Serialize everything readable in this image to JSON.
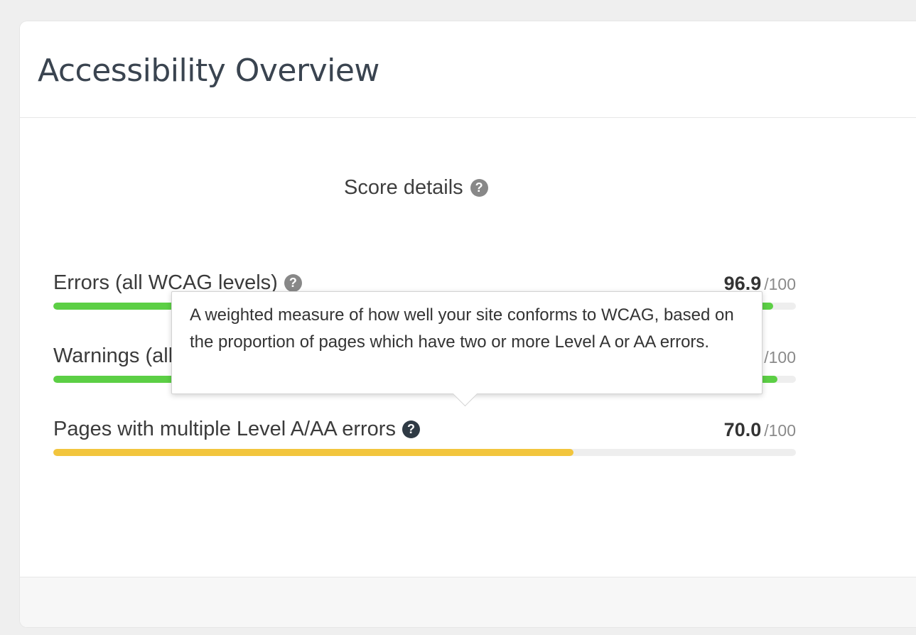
{
  "card": {
    "title": "Accessibility Overview"
  },
  "score_details": {
    "label": "Score details",
    "help_glyph": "?"
  },
  "metrics": [
    {
      "label": "Errors (all WCAG levels)",
      "value": "96.9",
      "max": "/100",
      "fraction": 0.969,
      "color": "#5ccf45"
    },
    {
      "label": "Warnings (all WCAG levels)",
      "value": "",
      "max": "/100",
      "fraction": 0.975,
      "color": "#5ccf45"
    },
    {
      "label": "Pages with multiple Level A/AA errors",
      "value": "70.0",
      "max": "/100",
      "fraction": 0.7,
      "color": "#f2c53d"
    }
  ],
  "tooltip": {
    "text": "A weighted measure of how well your site conforms to WCAG, based on the proportion of pages which have two or more Level A or AA errors."
  }
}
